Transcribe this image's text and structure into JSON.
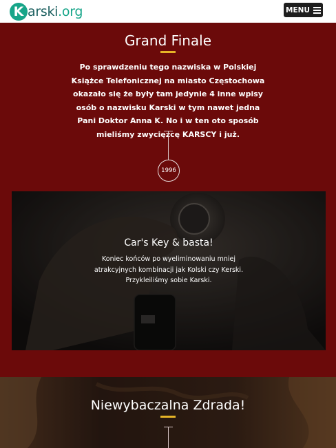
{
  "header": {
    "logo": {
      "letter": "K",
      "rest": "arski",
      "tld": ".org"
    },
    "menu_label": "MENU"
  },
  "grand_finale": {
    "title": "Grand Finale",
    "paragraph": "Po sprawdzeniu tego nazwiska w Polskiej Książce Telefonicznej na miasto Częstochowa okazało się że były tam jedynie 4 inne wpisy osób o nazwisku Karski w tym nawet jedna Pani Doktor Anna K. No i w ten oto sposób mieliśmy zwycięzcę KARSCY i już.",
    "year": "1996"
  },
  "card": {
    "title": "Car's Key & basta!",
    "text": "Koniec końców po wyeliminowaniu mniej atrakcyjnych kombinacji jak Kolski czy Kerski. Przykleiliśmy sobie Karski."
  },
  "next_section": {
    "title": "Niewybaczalna Zdrada!"
  },
  "colors": {
    "background": "#6b0a0a",
    "accent": "#e6b427",
    "logo_teal": "#17a589",
    "menu_bg": "#1e1e1e"
  },
  "icons": [
    "menu-hamburger-icon",
    "car-key-photo",
    "cave-photo"
  ]
}
